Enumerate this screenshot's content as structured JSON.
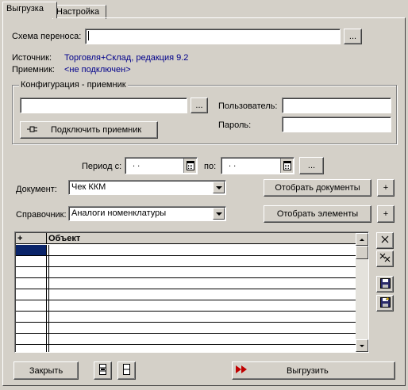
{
  "tabs": [
    {
      "label": "Выгрузка"
    },
    {
      "label": "Настройка"
    }
  ],
  "scheme": {
    "label": "Схема переноса:",
    "value": ""
  },
  "source": {
    "label": "Источник:",
    "value": "Торговля+Склад, редакция 9.2"
  },
  "receiver": {
    "label": "Приемник:",
    "value": "<не подключен>"
  },
  "config_group": {
    "title": "Конфигурация - приемник",
    "path_value": "",
    "user_label": "Пользователь:",
    "user_value": "",
    "password_label": "Пароль:",
    "password_value": "",
    "connect_label": "Подключить приемник"
  },
  "period": {
    "label": "Период с:",
    "from_value": ". .",
    "to_label": "по:",
    "to_value": ". ."
  },
  "document": {
    "label": "Документ:",
    "selected": "Чек ККМ",
    "button": "Отобрать документы"
  },
  "reference": {
    "label": "Справочник:",
    "selected": "Аналоги номенклатуры",
    "button": "Отобрать элементы"
  },
  "grid": {
    "col_plus": "+",
    "col_object": "Объект",
    "row_count": 10
  },
  "bottom": {
    "close_label": "Закрыть",
    "export_label": "Выгрузить"
  },
  "ellipsis": "...",
  "plus": "+",
  "colors": {
    "link_blue": "#00008b",
    "selection": "#0a246a",
    "export_arrow": "#c00000"
  }
}
